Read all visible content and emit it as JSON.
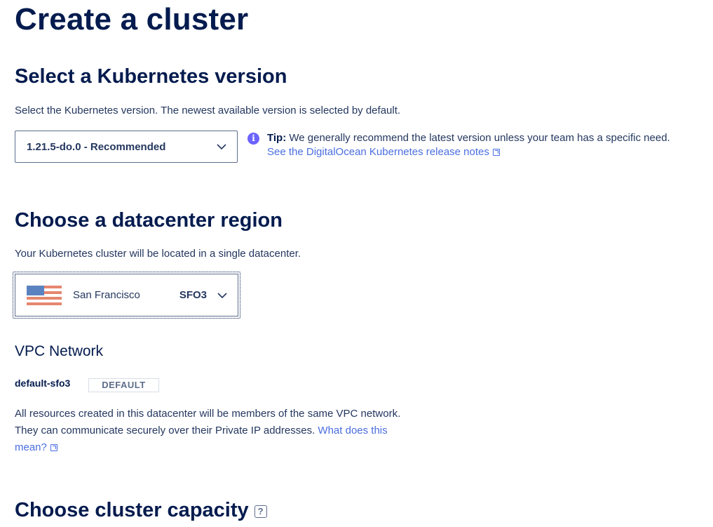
{
  "page": {
    "title": "Create a cluster"
  },
  "version_section": {
    "heading": "Select a Kubernetes version",
    "description": "Select the Kubernetes version. The newest available version is selected by default.",
    "selected_version": "1.21.5-do.0 - Recommended",
    "tip_label": "Tip:",
    "tip_text": " We generally recommend the latest version unless your team has a specific need.",
    "release_notes_link": "See the DigitalOcean Kubernetes release notes"
  },
  "region_section": {
    "heading": "Choose a datacenter region",
    "description": "Your Kubernetes cluster will be located in a single datacenter.",
    "selected_city": "San Francisco",
    "selected_code": "SFO3",
    "flag_icon": "us-flag-icon"
  },
  "vpc_section": {
    "heading": "VPC Network",
    "network_name": "default-sfo3",
    "badge": "DEFAULT",
    "description_line1": "All resources created in this datacenter will be members of the same VPC network.",
    "description_line2": "They can communicate securely over their Private IP addresses. ",
    "link_part1": "What does this",
    "link_part2": "mean?"
  },
  "capacity_section": {
    "heading": "Choose cluster capacity",
    "help_icon": "?"
  },
  "colors": {
    "heading": "#031b4e",
    "text": "#24375f",
    "link": "#4a6ee0",
    "tip_icon": "#6c63ff"
  }
}
